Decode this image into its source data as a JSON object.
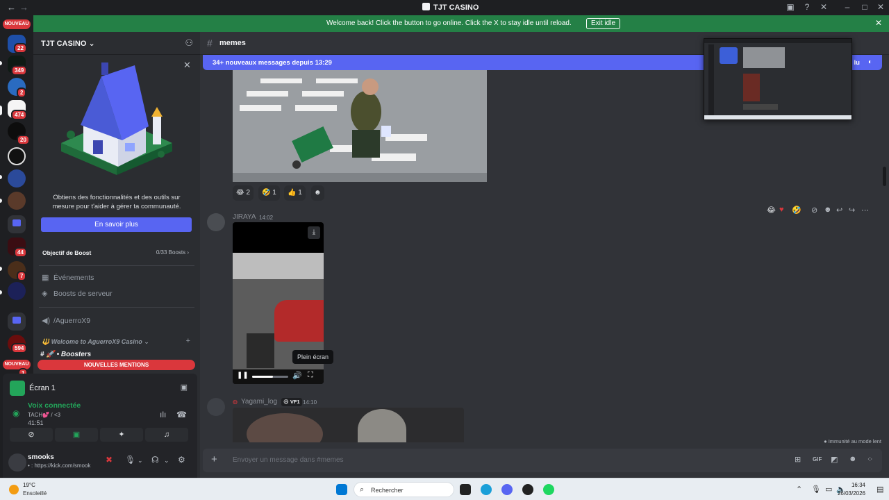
{
  "window": {
    "title": "TJT CASINO"
  },
  "banner": {
    "message": "Welcome back! Click the button to go online. Click the X to stay idle until reload.",
    "exit_label": "Exit idle"
  },
  "rail": {
    "badges": [
      "22",
      "349",
      "2",
      "474",
      "20",
      "44",
      "7",
      "594",
      "1"
    ],
    "nouveau_top": "NOUVEAU",
    "nouveau_bottom": "NOUVEAU"
  },
  "server": {
    "name": "TJT CASINO"
  },
  "promo": {
    "text": "Obtiens des fonctionnalités et des outils sur mesure pour t'aider à gérer ta communauté.",
    "button": "En savoir plus"
  },
  "boost": {
    "label": "Objectif de Boost",
    "count": "0/33 Boosts"
  },
  "channels": {
    "events": "Événements",
    "server_boosts": "Boosts de serveur",
    "voice_channel": "/AguerroX9",
    "category": "Welcome to AguerroX9 Casino",
    "boosters": "Boosters",
    "new_mentions": "NOUVELLES MENTIONS"
  },
  "voice": {
    "screen_label": "Écran 1",
    "status": "Voix connectée",
    "channel": "TACH💕 / <3",
    "timer": "41:51"
  },
  "user": {
    "name": "smooks",
    "status": "• : https://kick.com/smook"
  },
  "chat": {
    "channel": "memes",
    "new_messages": "34+ nouveaux messages depuis 13:29",
    "mark_read": "lu",
    "reactions": [
      {
        "emoji": "😂",
        "count": "2"
      },
      {
        "emoji": "🤣",
        "count": "1"
      },
      {
        "emoji": "👍",
        "count": "1"
      }
    ],
    "msg1_author": "JIRAYA",
    "msg1_time": "14:02",
    "tooltip": "Plein écran",
    "msg2_author": "Yagami_log",
    "msg2_tag": "VF1",
    "msg2_time": "14:10",
    "immunity": "Immunité au mode lent",
    "composer_placeholder": "Envoyer un message dans #memes"
  },
  "taskbar": {
    "temperature": "19°C",
    "condition": "Ensoleillé",
    "search_placeholder": "Rechercher",
    "time": "16:34",
    "date": "26/03/2026"
  }
}
